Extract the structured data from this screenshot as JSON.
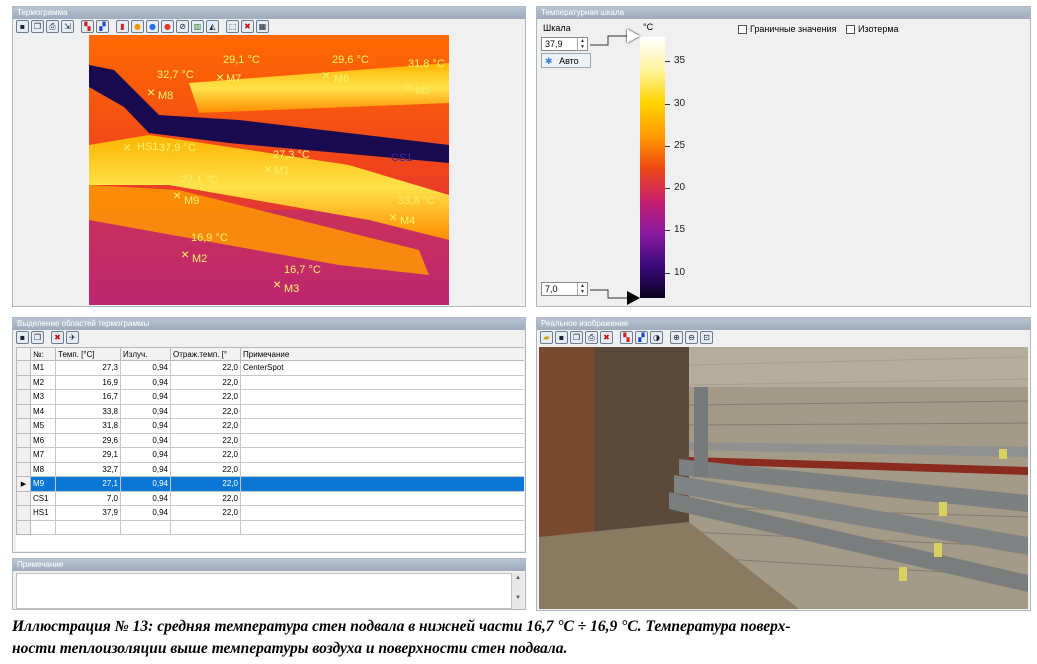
{
  "thermogram": {
    "title": "Термограмма",
    "toolbar_icons": [
      "save-icon",
      "copy-icon",
      "print-icon",
      "export-icon",
      "palette-swap-icon",
      "palette-swap-alt-icon",
      "thermometer-icon",
      "sun-icon",
      "point-blue-icon",
      "point-red-icon",
      "no-entry-icon",
      "histogram-icon",
      "profile-icon",
      "select-area-icon",
      "delete-icon",
      "grid-icon"
    ],
    "markers": [
      {
        "name": "M1",
        "temp": "27,3 °C"
      },
      {
        "name": "M2",
        "temp": "16,9 °C"
      },
      {
        "name": "M3",
        "temp": "16,7 °C"
      },
      {
        "name": "M4",
        "temp": "33,8 °C"
      },
      {
        "name": "M5",
        "temp": "31,8 °C"
      },
      {
        "name": "M6",
        "temp": "29,6 °C"
      },
      {
        "name": "M7",
        "temp": "29,1 °C"
      },
      {
        "name": "M8",
        "temp": "32,7 °C"
      },
      {
        "name": "M9",
        "temp": "27,1 °C"
      },
      {
        "name": "HS1",
        "temp": "37,9 °C"
      }
    ],
    "cs_label": "CS1"
  },
  "scale": {
    "title": "Температурная шкала",
    "label": "Шкала",
    "max_value": "37,9",
    "min_value": "7,0",
    "auto_label": "Авто",
    "unit": "°C",
    "ticks": [
      "35",
      "30",
      "25",
      "20",
      "15",
      "10"
    ],
    "checkbox_bounds": "Граничные значения",
    "checkbox_isotherm": "Изотерма",
    "gradient_colors": [
      "#ffffff",
      "#fff39a",
      "#ffd400",
      "#ff9a00",
      "#f04a14",
      "#c71f6e",
      "#8a1aa0",
      "#3a0a7a",
      "#0a0020"
    ]
  },
  "regions": {
    "title": "Выделение областей термограммы",
    "toolbar_icons": [
      "save-icon",
      "copy-icon",
      "delete-icon",
      "pin-icon"
    ],
    "columns": [
      "№:",
      "Темп. [°C]",
      "Излуч.",
      "Отраж.темп. [°",
      "Примечание"
    ],
    "rows": [
      {
        "id": "M1",
        "temp": "27,3",
        "emis": "0,94",
        "refl": "22,0",
        "note": "CenterSpot"
      },
      {
        "id": "M2",
        "temp": "16,9",
        "emis": "0,94",
        "refl": "22,0",
        "note": ""
      },
      {
        "id": "M3",
        "temp": "16,7",
        "emis": "0,94",
        "refl": "22,0",
        "note": ""
      },
      {
        "id": "M4",
        "temp": "33,8",
        "emis": "0,94",
        "refl": "22,0",
        "note": ""
      },
      {
        "id": "M5",
        "temp": "31,8",
        "emis": "0,94",
        "refl": "22,0",
        "note": ""
      },
      {
        "id": "M6",
        "temp": "29,6",
        "emis": "0,94",
        "refl": "22,0",
        "note": ""
      },
      {
        "id": "M7",
        "temp": "29,1",
        "emis": "0,94",
        "refl": "22,0",
        "note": ""
      },
      {
        "id": "M8",
        "temp": "32,7",
        "emis": "0,94",
        "refl": "22,0",
        "note": ""
      },
      {
        "id": "M9",
        "temp": "27,1",
        "emis": "0,94",
        "refl": "22,0",
        "note": ""
      },
      {
        "id": "CS1",
        "temp": "7,0",
        "emis": "0,94",
        "refl": "22,0",
        "note": ""
      },
      {
        "id": "HS1",
        "temp": "37,9",
        "emis": "0,94",
        "refl": "22,0",
        "note": ""
      }
    ],
    "selected_row": 8
  },
  "note_panel": {
    "title": "Примечание"
  },
  "real_image": {
    "title": "Реальное изображение",
    "toolbar_icons": [
      "open-icon",
      "save-icon",
      "copy-icon",
      "print-icon",
      "delete-icon",
      "palette-swap-icon",
      "palette-swap-alt-icon",
      "contrast-icon",
      "zoom-in-icon",
      "zoom-out-icon",
      "zoom-fit-icon"
    ]
  },
  "caption": {
    "line1": "Иллюстрация № 13: средняя температура стен подвала в нижней части 16,7 °С ÷ 16,9 °С. Температура поверх-",
    "line2": "ности теплоизоляции выше температуры воздуха и поверхности стен подвала."
  }
}
